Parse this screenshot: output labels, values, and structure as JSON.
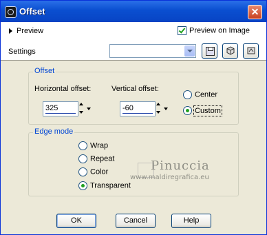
{
  "window": {
    "title": "Offset",
    "close_glyph": "✕"
  },
  "preview": {
    "label": "Preview",
    "preview_on_image_label": "Preview on Image",
    "preview_on_image_checked": true
  },
  "settings": {
    "label": "Settings",
    "value": "",
    "icons": [
      "save-icon",
      "load-preset-icon",
      "reset-icon"
    ]
  },
  "offset": {
    "group_title": "Offset",
    "horizontal_label": "Horizontal offset:",
    "horizontal_value": "325",
    "vertical_label": "Vertical offset:",
    "vertical_value": "-60",
    "options": [
      {
        "label": "Center",
        "selected": false
      },
      {
        "label": "Custom",
        "selected": true
      }
    ]
  },
  "edge_mode": {
    "group_title": "Edge mode",
    "options": [
      {
        "label": "Wrap",
        "selected": false
      },
      {
        "label": "Repeat",
        "selected": false
      },
      {
        "label": "Color",
        "selected": false
      },
      {
        "label": "Transparent",
        "selected": true
      }
    ]
  },
  "watermark": {
    "name": "Pinuccia",
    "url": "www.maldiregrafica.eu"
  },
  "buttons": {
    "ok": "OK",
    "cancel": "Cancel",
    "help": "Help"
  },
  "colors": {
    "title_bar": "#0a4fd0",
    "dialog_bg": "#ece9d8",
    "group_title": "#0046d5",
    "check_green": "#21a121"
  }
}
